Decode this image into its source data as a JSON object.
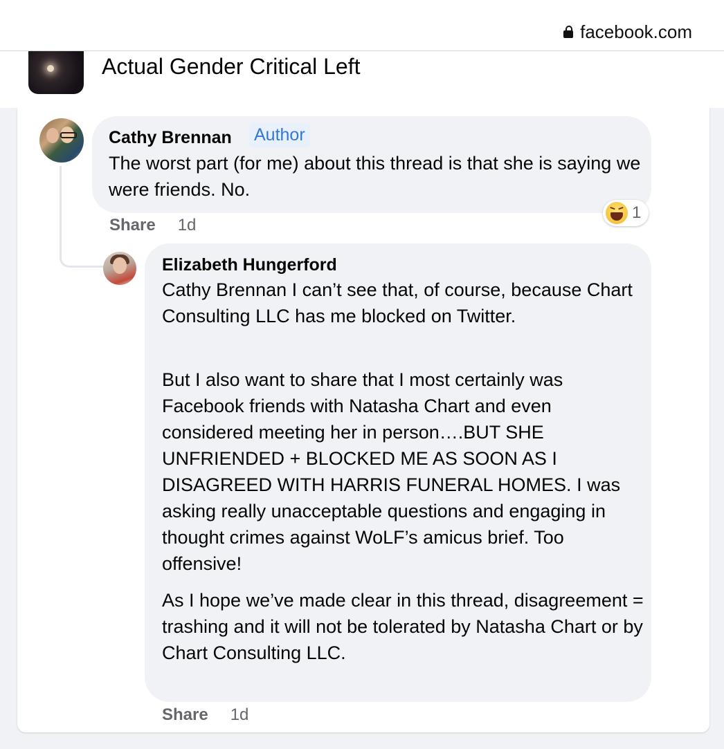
{
  "browser": {
    "url": "facebook.com",
    "lock_icon": "lock-icon"
  },
  "group": {
    "name": "Actual Gender Critical Left"
  },
  "comments": [
    {
      "author": "Cathy Brennan",
      "badge": "Author",
      "text": "The worst part (for me) about this thread is that she is saying we were friends. No.",
      "reaction_icon": "haha-icon",
      "reaction_count": "1",
      "share_label": "Share",
      "time": "1d"
    },
    {
      "author": "Elizabeth Hungerford",
      "paragraphs": [
        "Cathy Brennan I can’t see that, of course, because Chart Consulting LLC has me blocked on Twitter.",
        "But I also want to share that I most certainly was Facebook friends with Natasha Chart and even considered meeting her in person….BUT SHE UNFRIENDED + BLOCKED ME AS SOON AS I DISAGREED WITH HARRIS FUNERAL HOMES. I was asking really unacceptable questions and engaging in thought crimes against WoLF’s amicus brief. Too offensive!",
        "As I hope we’ve made clear in this thread, disagreement = trashing and it will not be tolerated by Natasha Chart or by Chart Consulting LLC."
      ],
      "share_label": "Share",
      "time": "1d"
    }
  ]
}
